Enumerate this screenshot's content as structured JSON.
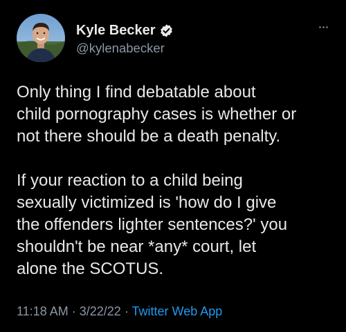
{
  "author": {
    "display_name": "Kyle Becker",
    "handle": "@kylenabecker",
    "verified": true,
    "avatar": "profile-photo-man-smiling"
  },
  "tweet": {
    "paragraph_1": [
      "Only thing I find debatable about",
      "child pornography cases is whether or",
      "not there should be a death penalty."
    ],
    "paragraph_2": [
      "If your reaction to a child being",
      "sexually victimized is 'how do I give",
      "the offenders lighter sentences?' you",
      "shouldn't be near *any* court, let",
      "alone the SCOTUS."
    ]
  },
  "meta": {
    "time": "11:18 AM",
    "date": "3/22/22",
    "separator": "·",
    "source": "Twitter Web App"
  },
  "colors": {
    "background": "#000000",
    "text": "#e7e9ea",
    "secondary": "#8b98a5",
    "accent": "#1d9bf0"
  },
  "icons": {
    "verified": "verified-badge-icon",
    "more": "more-options-icon"
  }
}
